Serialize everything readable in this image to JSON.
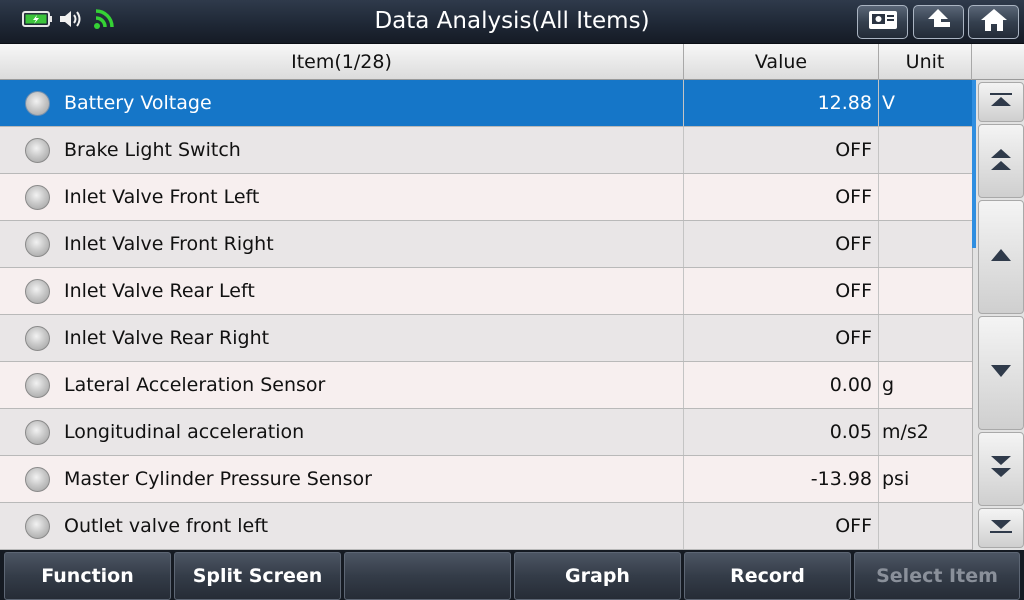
{
  "window": {
    "title": "Data Analysis(All Items)"
  },
  "status_icons": [
    "battery-charging-icon",
    "speaker-icon",
    "wifi-icon"
  ],
  "top_buttons": [
    "screenshot-icon",
    "back-icon",
    "home-icon"
  ],
  "table": {
    "headers": {
      "item": "Item(1/28)",
      "value": "Value",
      "unit": "Unit"
    },
    "rows": [
      {
        "name": "Battery Voltage",
        "value": "12.88",
        "unit": "V",
        "selected": true
      },
      {
        "name": "Brake Light Switch",
        "value": "OFF",
        "unit": ""
      },
      {
        "name": "Inlet Valve Front Left",
        "value": "OFF",
        "unit": ""
      },
      {
        "name": "Inlet Valve Front Right",
        "value": "OFF",
        "unit": ""
      },
      {
        "name": "Inlet Valve Rear Left",
        "value": "OFF",
        "unit": ""
      },
      {
        "name": "Inlet Valve Rear Right",
        "value": "OFF",
        "unit": ""
      },
      {
        "name": "Lateral Acceleration Sensor",
        "value": "0.00",
        "unit": "g"
      },
      {
        "name": "Longitudinal acceleration",
        "value": "0.05",
        "unit": "m/s2"
      },
      {
        "name": "Master Cylinder Pressure Sensor",
        "value": "-13.98",
        "unit": "psi"
      },
      {
        "name": "Outlet valve front left",
        "value": "OFF",
        "unit": ""
      }
    ]
  },
  "scroll_buttons": [
    "scroll-top-icon",
    "page-up-icon",
    "line-up-icon",
    "line-down-icon",
    "page-down-icon",
    "scroll-bottom-icon"
  ],
  "toolbar": {
    "function": "Function",
    "split_screen": "Split Screen",
    "empty": "",
    "graph": "Graph",
    "record": "Record",
    "select_item": "Select Item"
  },
  "colors": {
    "selected_row": "#1576c8",
    "scroll_thumb": "#2f8ee0"
  }
}
